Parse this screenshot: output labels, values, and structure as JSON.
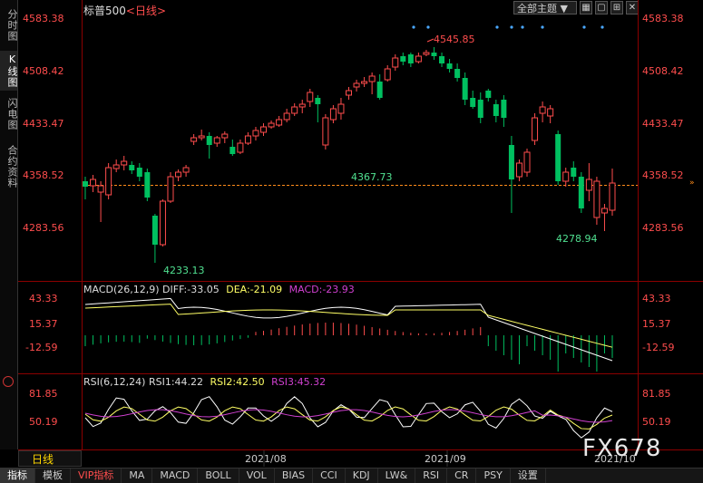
{
  "side_tabs": [
    {
      "label": "分时图",
      "active": false
    },
    {
      "label": "K线图",
      "active": true
    },
    {
      "label": "闪电图",
      "active": false
    },
    {
      "label": "合约资料",
      "active": false
    }
  ],
  "header": {
    "symbol": "标普500",
    "period_tag": "<日线>"
  },
  "toolbar": {
    "theme_label": "全部主题",
    "theme_arrow": "▼",
    "buttons": [
      "▦",
      "▢",
      "⊞",
      "✕"
    ]
  },
  "price_axis": {
    "ticks": [
      "4583.38",
      "4508.42",
      "4433.47",
      "4358.52",
      "4283.56"
    ],
    "current_line": "4358.52"
  },
  "price_annotations": {
    "high": "4545.85",
    "low_main": "4233.13",
    "mid": "4367.73",
    "low_recent": "4278.94"
  },
  "macd": {
    "label": "MACD(26,12,9)",
    "diff_label": "DIFF:-33.05",
    "dea_label": "DEA:-21.09",
    "macd_label": "MACD:-23.93",
    "ticks": [
      "43.33",
      "15.37",
      "-12.59"
    ]
  },
  "rsi": {
    "label": "RSI(6,12,24)",
    "rsi1_label": "RSI1:44.22",
    "rsi2_label": "RSI2:42.50",
    "rsi3_label": "RSI3:45.32",
    "ticks": [
      "81.85",
      "50.19"
    ]
  },
  "time_axis": {
    "labels": [
      "2021/08",
      "2021/09",
      "2021/10"
    ]
  },
  "period_selector": {
    "label": "日线"
  },
  "bottom_tabs": [
    "指标",
    "模板",
    "VIP指标",
    "MA",
    "MACD",
    "BOLL",
    "VOL",
    "BIAS",
    "CCI",
    "KDJ",
    "LW&",
    "RSI",
    "CR",
    "PSY",
    "设置"
  ],
  "watermark": "FX678",
  "colors": {
    "up": "#ff4d4d",
    "down": "#00c060",
    "diff": "#ffffff",
    "dea": "#ffff66",
    "rsi3": "#d040d0",
    "axis": "#ff4d4d",
    "grid": "#8b0000"
  }
}
